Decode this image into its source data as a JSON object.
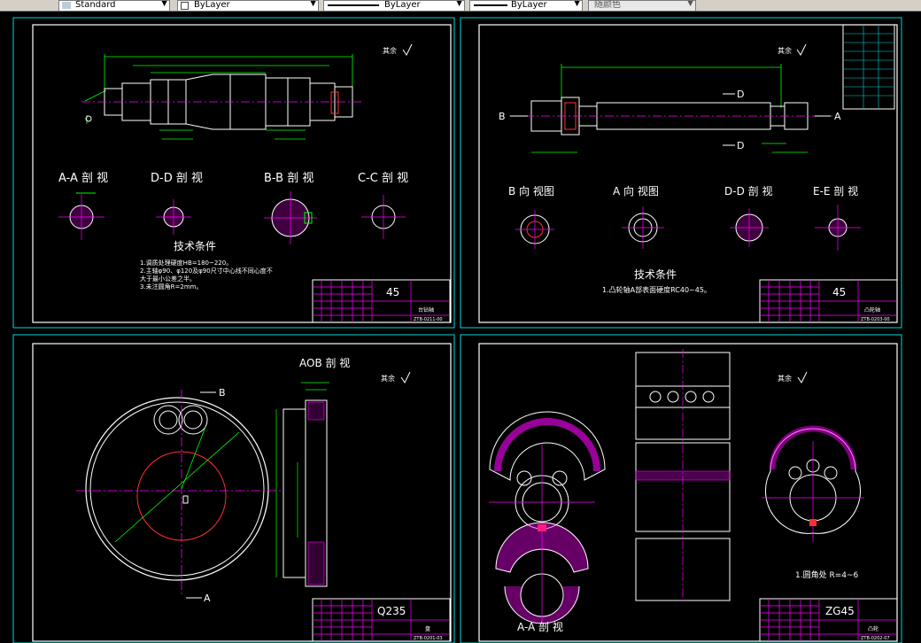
{
  "toolbar": {
    "text_style": "Standard",
    "layer": "ByLayer",
    "linetype": "ByLayer",
    "lineweight": "ByLayer",
    "color": "随颜色"
  },
  "colors": {
    "bg": "#000000",
    "frame": "#00d8d8",
    "dim": "#00ff00",
    "center": "#ff00ff",
    "outline": "#ffffff",
    "titleblock": "#ff00ff"
  },
  "sheets": {
    "s1": {
      "note": "其余",
      "views": [
        "A-A 剖 视",
        "D-D 剖 视",
        "B-B 剖 视",
        "C-C 剖 视"
      ],
      "req_title": "技术条件",
      "req_lines": [
        "1.调质处理硬度HB=180~220。",
        "2.主轴φ90、φ120及φ90尺寸中心线不同心度不",
        "大于最小公差之半。",
        "3.未注圆角R=2mm。"
      ],
      "material": "45",
      "name": "台钻轴",
      "code": "ZTB-0211-00"
    },
    "s2": {
      "note": "其余",
      "views": [
        "B 向 视图",
        "A 向 视图",
        "D-D 剖 视",
        "E-E 剖 视"
      ],
      "marks": {
        "a": "A",
        "b": "B",
        "d": "D"
      },
      "req_title": "技术条件",
      "req_lines": [
        "1.凸轮轴A部表面硬度RC40~45。"
      ],
      "material": "45",
      "name": "凸轮轴",
      "code": "ZTB-0203-00"
    },
    "s3": {
      "note": "其余",
      "view": "AOB 剖 视",
      "marks": {
        "a": "A",
        "b": "B"
      },
      "material": "Q235",
      "name": "盘",
      "code": "ZTB-0201-03"
    },
    "s4": {
      "note": "其余",
      "view": "A-A 剖 视",
      "req_lines": [
        "1.圆角处 R=4~6"
      ],
      "material": "ZG45",
      "name": "凸轮",
      "code": "ZTB-0202-07"
    }
  }
}
